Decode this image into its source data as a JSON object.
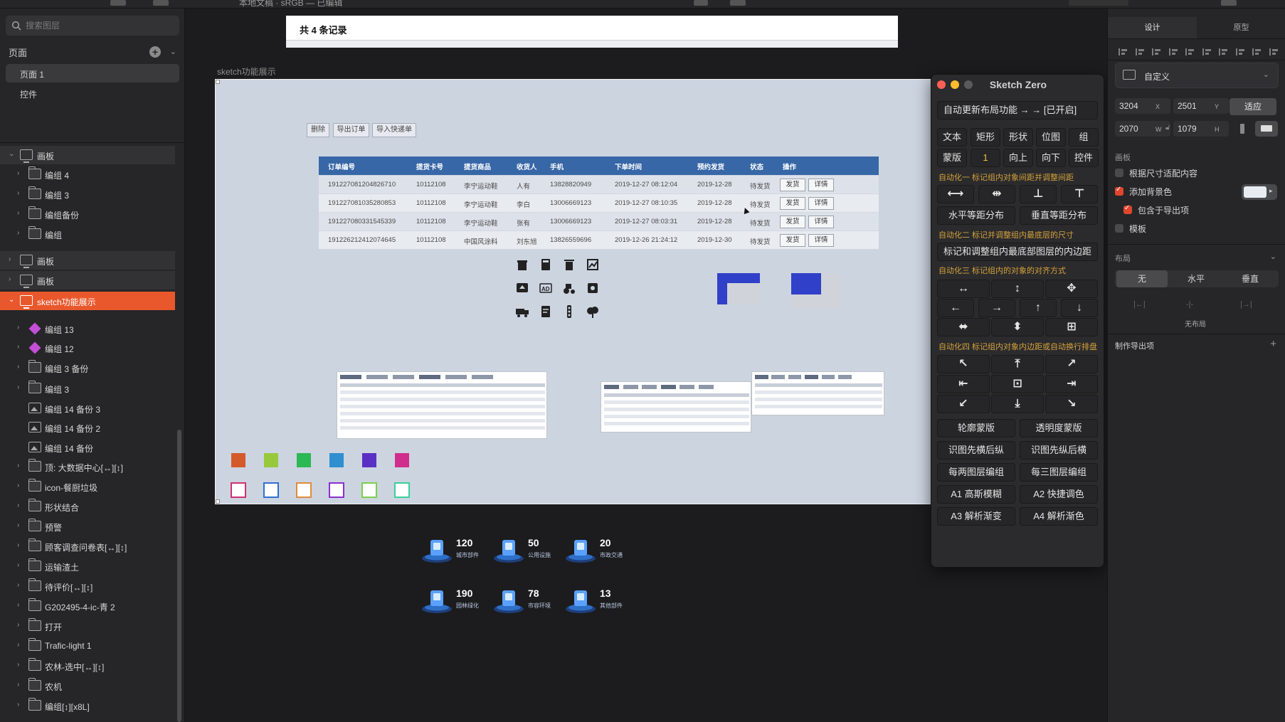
{
  "toolbar": {
    "document_title": "本地文稿 · sRGB — 已编辑"
  },
  "sidebar": {
    "search_placeholder": "搜索图层",
    "pages_label": "页面",
    "pages": [
      "页面 1",
      "控件"
    ],
    "layers": [
      {
        "label": "画板",
        "type": "artboard",
        "expanded": true
      },
      {
        "label": "编组 4",
        "type": "folder"
      },
      {
        "label": "编组 3",
        "type": "folder"
      },
      {
        "label": "编组备份",
        "type": "folder"
      },
      {
        "label": "编组",
        "type": "folder"
      },
      {
        "label": "画板",
        "type": "artboard",
        "expanded": false
      },
      {
        "label": "画板",
        "type": "artboard",
        "expanded": false
      },
      {
        "label": "sketch功能展示",
        "type": "artboard",
        "expanded": true,
        "selected": true
      },
      {
        "label": "编组 13",
        "type": "symbol"
      },
      {
        "label": "编组 12",
        "type": "symbol"
      },
      {
        "label": "编组 3 备份",
        "type": "folder"
      },
      {
        "label": "编组 3",
        "type": "folder"
      },
      {
        "label": "编组 14 备份 3",
        "type": "image"
      },
      {
        "label": "编组 14 备份 2",
        "type": "image"
      },
      {
        "label": "编组 14 备份",
        "type": "image"
      },
      {
        "label": "顶: 大数据中心[↔][↕]",
        "type": "folder"
      },
      {
        "label": "icon-餐厨垃圾",
        "type": "folder"
      },
      {
        "label": "形状结合",
        "type": "folder"
      },
      {
        "label": "预警",
        "type": "folder"
      },
      {
        "label": "顾客调查问卷表[↔][↕]",
        "type": "folder"
      },
      {
        "label": "运输渣土",
        "type": "folder"
      },
      {
        "label": "待评价[↔][↕]",
        "type": "folder"
      },
      {
        "label": "G202495-4-ic-青 2",
        "type": "folder"
      },
      {
        "label": "打开",
        "type": "folder"
      },
      {
        "label": "Trafic-light 1",
        "type": "folder"
      },
      {
        "label": "农林-选中[↔][↕]",
        "type": "folder"
      },
      {
        "label": "农机",
        "type": "folder"
      },
      {
        "label": "编组[↕][x8L]",
        "type": "folder"
      }
    ]
  },
  "canvas": {
    "top_board_text": "共 4 条记录",
    "artboard_label": "sketch功能展示",
    "action_buttons": [
      "删除",
      "导出订单",
      "导入快递单"
    ],
    "table": {
      "headers": [
        "订单编号",
        "提货卡号",
        "提货商品",
        "收货人",
        "手机",
        "下单时间",
        "预约发货",
        "状态",
        "操作"
      ],
      "rows": [
        [
          "191227081204826710",
          "10112108",
          "李宁运动鞋",
          "人有",
          "13828820949",
          "2019-12-27 08:12:04",
          "2019-12-28",
          "待发货",
          "发货",
          "详情"
        ],
        [
          "191227081035280853",
          "10112108",
          "李宁运动鞋",
          "李白",
          "13006669123",
          "2019-12-27 08:10:35",
          "2019-12-28",
          "待发货",
          "发货",
          "详情"
        ],
        [
          "191227080331545339",
          "10112108",
          "李宁运动鞋",
          "张有",
          "13006669123",
          "2019-12-27 08:03:31",
          "2019-12-28",
          "待发货",
          "发货",
          "详情"
        ],
        [
          "191226212412074645",
          "10112108",
          "中国风涂料",
          "刘东旭",
          "13826559696",
          "2019-12-26 21:24:12",
          "2019-12-30",
          "待发货",
          "发货",
          "详情"
        ]
      ]
    },
    "filled_swatches": [
      "#d55a2a",
      "#98c93c",
      "#2cb855",
      "#2f8fd0",
      "#5a2fc4",
      "#d02e8c"
    ],
    "outline_swatches": [
      "#d0306e",
      "#2f6fd0",
      "#e08a3a",
      "#8a2fd0",
      "#7cd04a",
      "#38d09a"
    ],
    "stats": [
      {
        "value": "120",
        "caption": "城市部件"
      },
      {
        "value": "50",
        "caption": "公用设施"
      },
      {
        "value": "20",
        "caption": "市政交通"
      },
      {
        "value": "190",
        "caption": "园林绿化"
      },
      {
        "value": "78",
        "caption": "市容环境"
      },
      {
        "value": "13",
        "caption": "其他部件"
      }
    ]
  },
  "sketch_zero": {
    "title": "Sketch Zero",
    "auto_update": "自动更新布局功能 → → [已开启]",
    "row1": [
      "文本",
      "矩形",
      "形状",
      "位图",
      "组"
    ],
    "row2": [
      "蒙版",
      "1",
      "向上",
      "向下",
      "控件"
    ],
    "note1": "自动化一 标记组内对象间距并调整间距",
    "dist_h": "水平等距分布",
    "dist_v": "垂直等距分布",
    "note2": "自动化二 标记并调整组内最底层的尺寸",
    "padding_btn": "标记和调整组内最底部图层的内边距",
    "note3": "自动化三 标记组内的对象的对齐方式",
    "note4": "自动化四 标记组内对象内边距或自动换行排盘",
    "pairs": [
      [
        "轮廓蒙版",
        "透明度蒙版"
      ],
      [
        "识图先横后纵",
        "识图先纵后横"
      ],
      [
        "每两图层编组",
        "每三图层编组"
      ],
      [
        "A1 高斯模糊",
        "A2 快捷调色"
      ],
      [
        "A3 解析渐变",
        "A4 解析渐色"
      ]
    ]
  },
  "inspector": {
    "tabs": [
      "设计",
      "原型"
    ],
    "preset": "自定义",
    "x": "3204",
    "x_label": "X",
    "y": "2501",
    "y_label": "Y",
    "w": "2070",
    "w_label": "W",
    "h": "1079",
    "h_label": "H",
    "fit": "适应",
    "artboard_section": "画板",
    "resize_content": "根据尺寸适配内容",
    "add_bg": "添加背景色",
    "include_export": "包含于导出项",
    "template": "模板",
    "layout_section": "布局",
    "layout_options": [
      "无",
      "水平",
      "垂直"
    ],
    "no_layout": "无布局",
    "export_section": "制作导出项"
  }
}
